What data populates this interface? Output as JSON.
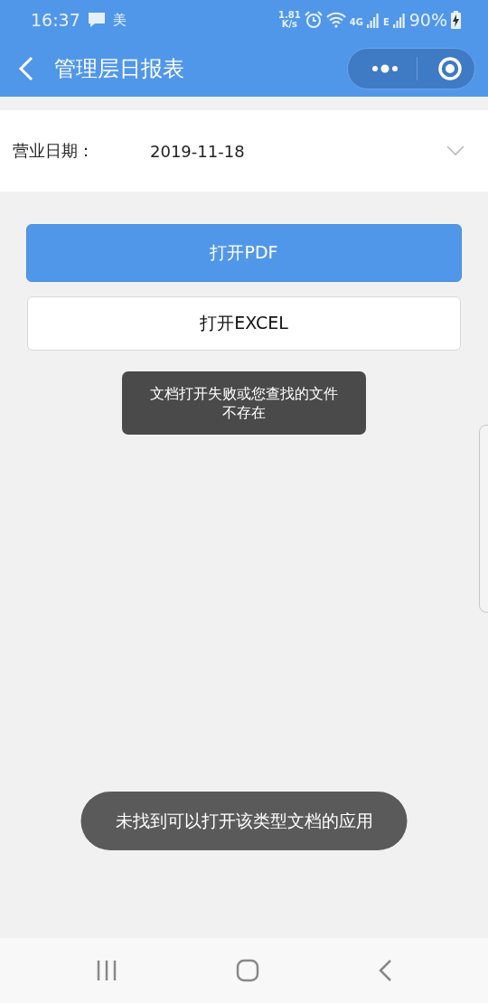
{
  "status_bar": {
    "time": "16:37",
    "app_label": "美",
    "speed_value": "1.81",
    "speed_unit": "K/s",
    "network_1": "4G",
    "network_2": "E",
    "battery": "90%"
  },
  "nav_bar": {
    "title": "管理层日报表"
  },
  "date_field": {
    "label": "营业日期：",
    "value": "2019-11-18"
  },
  "buttons": [
    {
      "label": "打开PDF",
      "kind": "primary"
    },
    {
      "label": "打开EXCEL",
      "kind": "default"
    }
  ],
  "toasts": [
    {
      "text": "文档打开失败或您查找的文件不存在",
      "kind": "box"
    },
    {
      "text": "未找到可以打开该类型文档的应用",
      "kind": "pill"
    }
  ]
}
